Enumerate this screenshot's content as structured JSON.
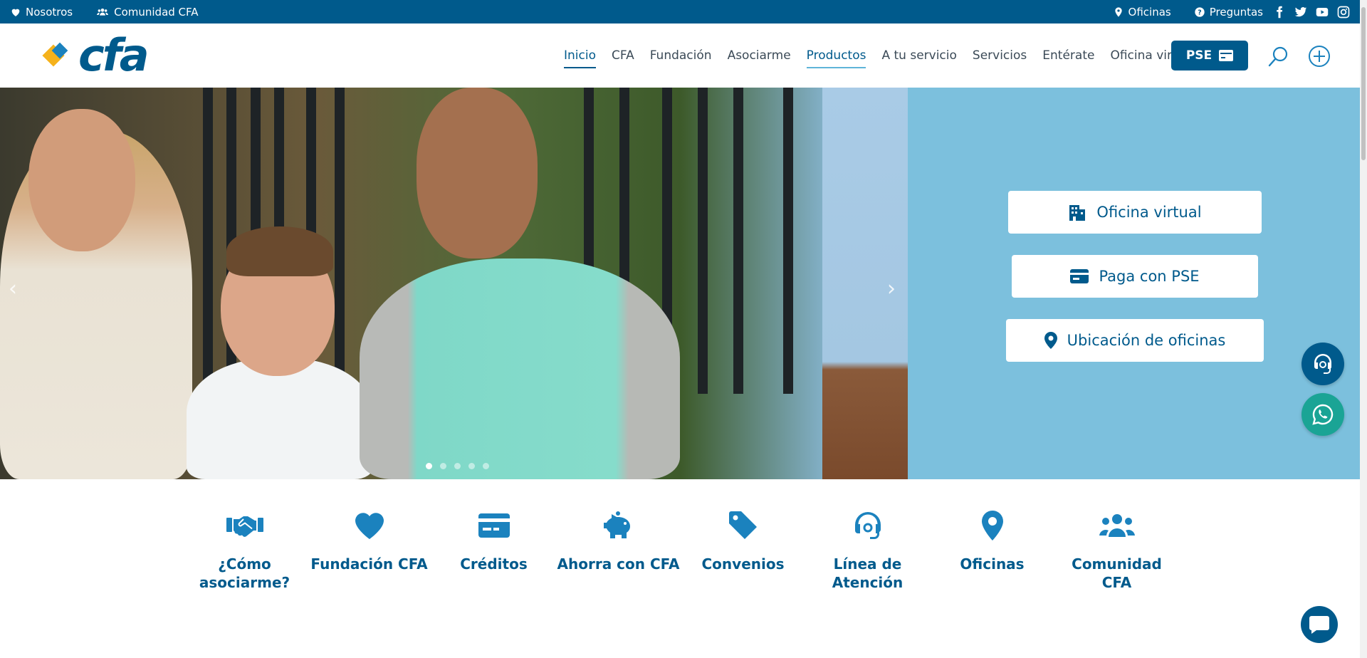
{
  "topbar": {
    "left": [
      {
        "label": "Nosotros",
        "icon": "heart-icon"
      },
      {
        "label": "Comunidad CFA",
        "icon": "users-icon"
      }
    ],
    "right": [
      {
        "label": "Oficinas",
        "icon": "location-icon"
      },
      {
        "label": "Preguntas",
        "icon": "question-icon"
      }
    ],
    "social": [
      "facebook-icon",
      "twitter-icon",
      "youtube-icon",
      "instagram-icon"
    ]
  },
  "header": {
    "logo_text": "cfa",
    "nav": [
      {
        "label": "Inicio",
        "state": "active"
      },
      {
        "label": "CFA",
        "state": ""
      },
      {
        "label": "Fundación",
        "state": ""
      },
      {
        "label": "Asociarme",
        "state": ""
      },
      {
        "label": "Productos",
        "state": "hover"
      },
      {
        "label": "A tu servicio",
        "state": ""
      },
      {
        "label": "Servicios",
        "state": ""
      },
      {
        "label": "Entérate",
        "state": ""
      },
      {
        "label": "Oficina virtual",
        "state": ""
      }
    ],
    "pse_label": "PSE"
  },
  "hero": {
    "slide_count": 5,
    "active_slide": 1,
    "prev_symbol": "‹",
    "next_symbol": "›"
  },
  "quick_actions": [
    {
      "label": "Oficina virtual",
      "icon": "building-icon"
    },
    {
      "label": "Paga con PSE",
      "icon": "card-icon"
    },
    {
      "label": "Ubicación de oficinas",
      "icon": "location-icon"
    }
  ],
  "shortcuts": [
    {
      "label": "¿Cómo asociarme?",
      "icon": "handshake-icon"
    },
    {
      "label": "Fundación CFA",
      "icon": "heart-icon"
    },
    {
      "label": "Créditos",
      "icon": "credit-card-icon"
    },
    {
      "label": "Ahorra con CFA",
      "icon": "piggy-bank-icon"
    },
    {
      "label": "Convenios",
      "icon": "tag-icon"
    },
    {
      "label": "Línea de Atención",
      "icon": "headset-icon"
    },
    {
      "label": "Oficinas",
      "icon": "location-icon"
    },
    {
      "label": "Comunidad CFA",
      "icon": "users-icon"
    }
  ],
  "colors": {
    "brand_dark": "#005a8c",
    "brand_light": "#1b82be",
    "panel_bg": "#7cc0dd",
    "whatsapp": "#1aa495",
    "logo_yellow": "#f5b21c"
  }
}
